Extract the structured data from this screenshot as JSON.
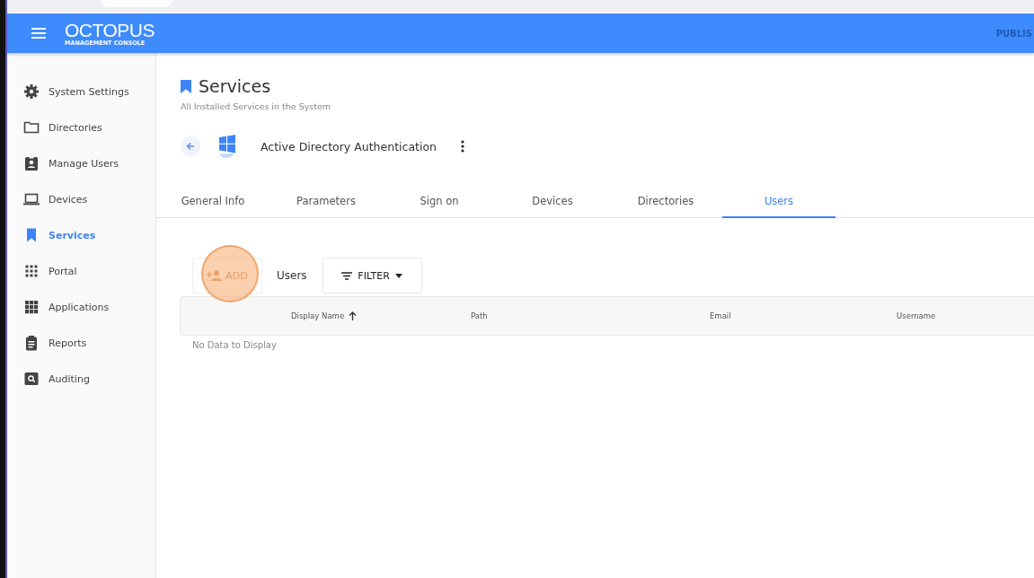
{
  "header": {
    "logo": "OCTOPUS",
    "logo_subtitle": "MANAGEMENT CONSOLE",
    "right_text": "PUBLIS"
  },
  "sidebar": {
    "items": [
      {
        "label": "System Settings",
        "selected": false
      },
      {
        "label": "Directories",
        "selected": false
      },
      {
        "label": "Manage Users",
        "selected": false
      },
      {
        "label": "Devices",
        "selected": false
      },
      {
        "label": "Services",
        "selected": true
      },
      {
        "label": "Portal",
        "selected": false
      },
      {
        "label": "Applications",
        "selected": false
      },
      {
        "label": "Reports",
        "selected": false
      },
      {
        "label": "Auditing",
        "selected": false
      }
    ]
  },
  "page": {
    "title": "Services",
    "subtitle": "All Installed Services in the System"
  },
  "service": {
    "name": "Active Directory Authentication"
  },
  "tabs": [
    {
      "label": "General Info",
      "selected": false
    },
    {
      "label": "Parameters",
      "selected": false
    },
    {
      "label": "Sign on",
      "selected": false
    },
    {
      "label": "Devices",
      "selected": false
    },
    {
      "label": "Directories",
      "selected": false
    },
    {
      "label": "Users",
      "selected": true
    }
  ],
  "toolbar": {
    "add_button": "ADD",
    "label": "Users",
    "filter_button": "FILTER",
    "click_highlight": true
  },
  "table": {
    "columns": [
      {
        "label": "Display Name",
        "sorted": true
      },
      {
        "label": "Path",
        "sorted": false
      },
      {
        "label": "Email",
        "sorted": false
      },
      {
        "label": "Username",
        "sorted": false
      }
    ],
    "empty_text": "No Data to Display"
  }
}
